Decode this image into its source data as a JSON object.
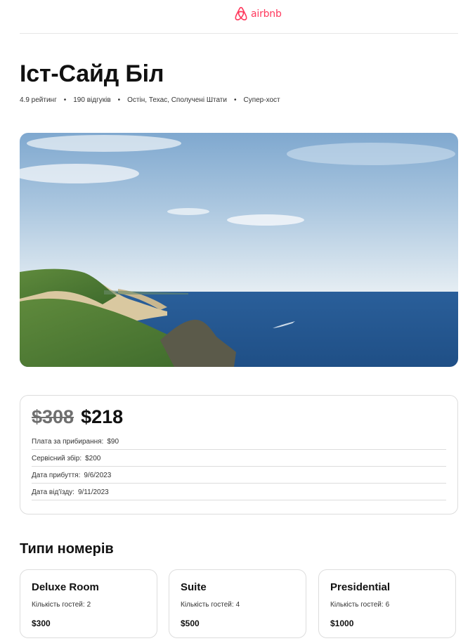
{
  "header": {
    "logo_text": "airbnb",
    "logo_icon": "airbnb-belo-icon",
    "brand_color": "#ff385c"
  },
  "listing": {
    "title": "Іст-Сайд Біл",
    "rating": "4.9 рейтинг",
    "reviews": "190 відгуків",
    "location": "Остін, Техас, Сполучені Штати",
    "host_status": "Супер-хост",
    "separator": "•"
  },
  "hero_image": {
    "description_icon": "coastal-cliffs-photo"
  },
  "pricing": {
    "old_price": "$308",
    "new_price": "$218",
    "rows": [
      {
        "label": "Плата за прибирання:",
        "value": "$90"
      },
      {
        "label": "Сервісний збір:",
        "value": "$200"
      },
      {
        "label": "Дата прибуття:",
        "value": "9/6/2023"
      },
      {
        "label": "Дата від'їзду:",
        "value": "9/11/2023"
      }
    ]
  },
  "rooms": {
    "title": "Типи номерів",
    "guests_label": "Кількість гостей:",
    "items": [
      {
        "name": "Deluxe Room",
        "guests": "2",
        "price": "$300"
      },
      {
        "name": "Suite",
        "guests": "4",
        "price": "$500"
      },
      {
        "name": "Presidential",
        "guests": "6",
        "price": "$1000"
      }
    ]
  }
}
